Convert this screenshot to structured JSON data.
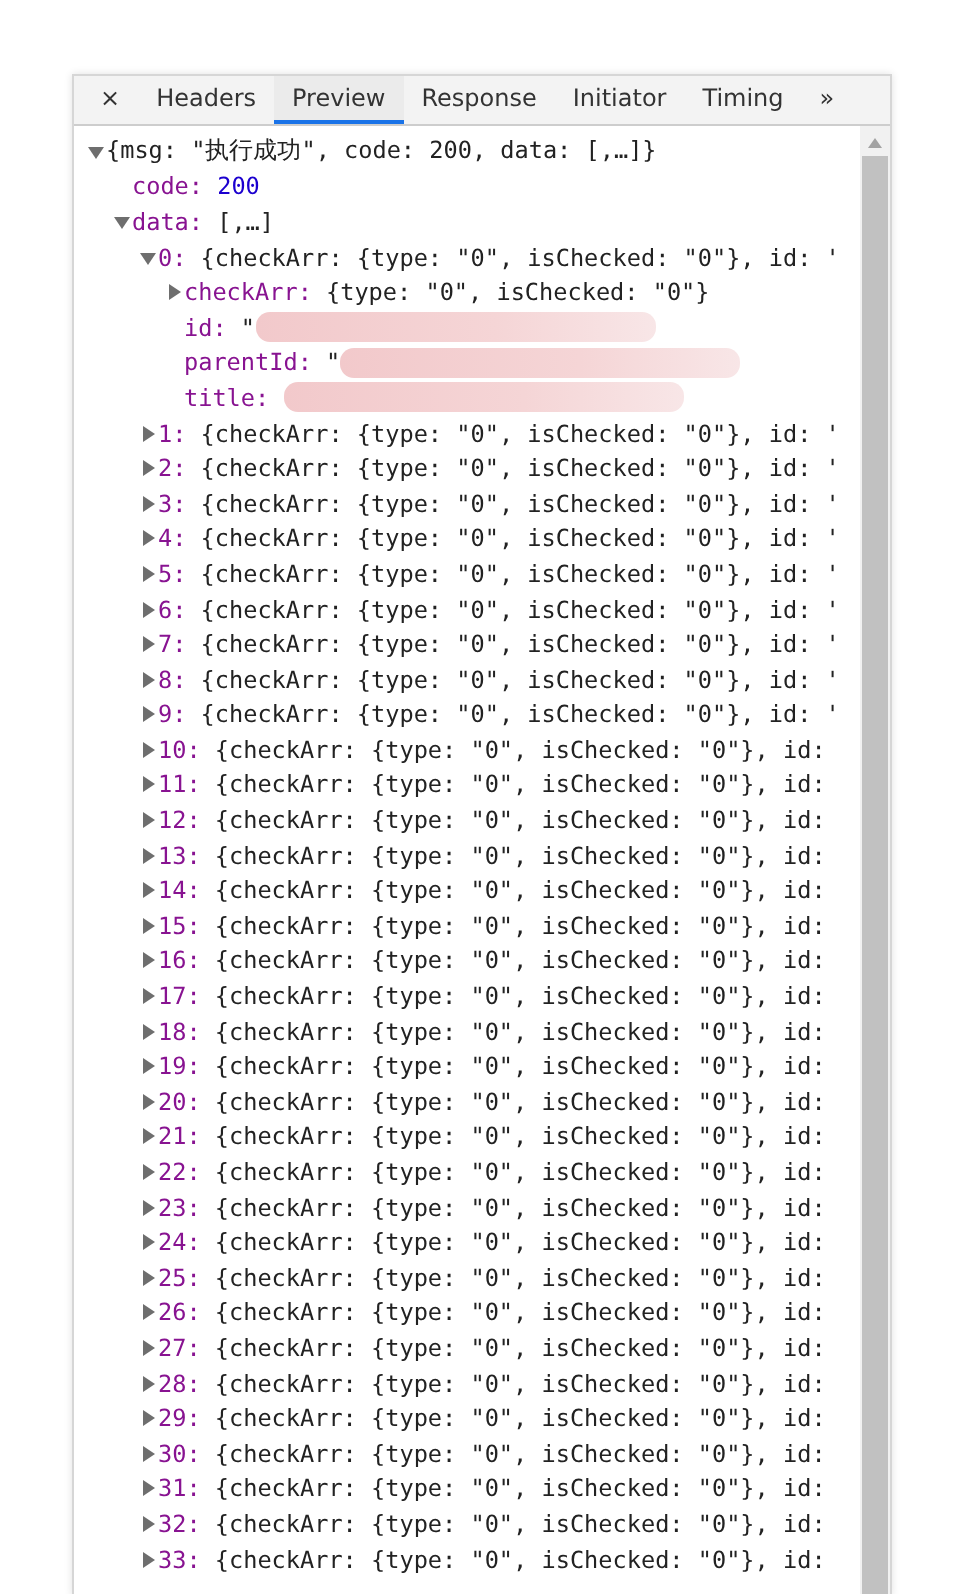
{
  "tabs": [
    {
      "label": "×",
      "kind": "close"
    },
    {
      "label": "Headers",
      "kind": "tab",
      "selected": false
    },
    {
      "label": "Preview",
      "kind": "tab",
      "selected": true
    },
    {
      "label": "Response",
      "kind": "tab",
      "selected": false
    },
    {
      "label": "Initiator",
      "kind": "tab",
      "selected": false
    },
    {
      "label": "Timing",
      "kind": "tab",
      "selected": false
    },
    {
      "label": "»",
      "kind": "more"
    }
  ],
  "tree": {
    "value": "{msg: \"执行成功\", code: 200, data: [,…]}",
    "expanded": true,
    "children": [
      {
        "key": "code:",
        "value": "200",
        "kind": "number"
      },
      {
        "key": "data:",
        "value": "[,…]",
        "expanded": true,
        "children": [
          {
            "key": "0:",
            "value": "{checkArr: {type: \"0\", isChecked: \"0\"}, id: '",
            "expanded": true,
            "children": [
              {
                "key": "checkArr:",
                "value": "{type: \"0\", isChecked: \"0\"}",
                "expanded": false
              },
              {
                "key": "id:",
                "value": "\"",
                "redacted": true
              },
              {
                "key": "parentId:",
                "value": "\"",
                "redacted": true
              },
              {
                "key": "title:",
                "redacted": true
              }
            ]
          },
          {
            "key": "1:",
            "value": "{checkArr: {type: \"0\", isChecked: \"0\"}, id: '",
            "expanded": false
          },
          {
            "key": "2:",
            "value": "{checkArr: {type: \"0\", isChecked: \"0\"}, id: '",
            "expanded": false
          },
          {
            "key": "3:",
            "value": "{checkArr: {type: \"0\", isChecked: \"0\"}, id: '",
            "expanded": false
          },
          {
            "key": "4:",
            "value": "{checkArr: {type: \"0\", isChecked: \"0\"}, id: '",
            "expanded": false
          },
          {
            "key": "5:",
            "value": "{checkArr: {type: \"0\", isChecked: \"0\"}, id: '",
            "expanded": false
          },
          {
            "key": "6:",
            "value": "{checkArr: {type: \"0\", isChecked: \"0\"}, id: '",
            "expanded": false
          },
          {
            "key": "7:",
            "value": "{checkArr: {type: \"0\", isChecked: \"0\"}, id: '",
            "expanded": false
          },
          {
            "key": "8:",
            "value": "{checkArr: {type: \"0\", isChecked: \"0\"}, id: '",
            "expanded": false
          },
          {
            "key": "9:",
            "value": "{checkArr: {type: \"0\", isChecked: \"0\"}, id: '",
            "expanded": false
          },
          {
            "key": "10:",
            "value": "{checkArr: {type: \"0\", isChecked: \"0\"}, id:",
            "expanded": false
          },
          {
            "key": "11:",
            "value": "{checkArr: {type: \"0\", isChecked: \"0\"}, id:",
            "expanded": false
          },
          {
            "key": "12:",
            "value": "{checkArr: {type: \"0\", isChecked: \"0\"}, id:",
            "expanded": false
          },
          {
            "key": "13:",
            "value": "{checkArr: {type: \"0\", isChecked: \"0\"}, id:",
            "expanded": false
          },
          {
            "key": "14:",
            "value": "{checkArr: {type: \"0\", isChecked: \"0\"}, id:",
            "expanded": false
          },
          {
            "key": "15:",
            "value": "{checkArr: {type: \"0\", isChecked: \"0\"}, id:",
            "expanded": false
          },
          {
            "key": "16:",
            "value": "{checkArr: {type: \"0\", isChecked: \"0\"}, id:",
            "expanded": false
          },
          {
            "key": "17:",
            "value": "{checkArr: {type: \"0\", isChecked: \"0\"}, id:",
            "expanded": false
          },
          {
            "key": "18:",
            "value": "{checkArr: {type: \"0\", isChecked: \"0\"}, id:",
            "expanded": false
          },
          {
            "key": "19:",
            "value": "{checkArr: {type: \"0\", isChecked: \"0\"}, id:",
            "expanded": false
          },
          {
            "key": "20:",
            "value": "{checkArr: {type: \"0\", isChecked: \"0\"}, id:",
            "expanded": false
          },
          {
            "key": "21:",
            "value": "{checkArr: {type: \"0\", isChecked: \"0\"}, id:",
            "expanded": false
          },
          {
            "key": "22:",
            "value": "{checkArr: {type: \"0\", isChecked: \"0\"}, id:",
            "expanded": false
          },
          {
            "key": "23:",
            "value": "{checkArr: {type: \"0\", isChecked: \"0\"}, id:",
            "expanded": false
          },
          {
            "key": "24:",
            "value": "{checkArr: {type: \"0\", isChecked: \"0\"}, id:",
            "expanded": false
          },
          {
            "key": "25:",
            "value": "{checkArr: {type: \"0\", isChecked: \"0\"}, id:",
            "expanded": false
          },
          {
            "key": "26:",
            "value": "{checkArr: {type: \"0\", isChecked: \"0\"}, id:",
            "expanded": false
          },
          {
            "key": "27:",
            "value": "{checkArr: {type: \"0\", isChecked: \"0\"}, id:",
            "expanded": false
          },
          {
            "key": "28:",
            "value": "{checkArr: {type: \"0\", isChecked: \"0\"}, id:",
            "expanded": false
          },
          {
            "key": "29:",
            "value": "{checkArr: {type: \"0\", isChecked: \"0\"}, id:",
            "expanded": false
          },
          {
            "key": "30:",
            "value": "{checkArr: {type: \"0\", isChecked: \"0\"}, id:",
            "expanded": false
          },
          {
            "key": "31:",
            "value": "{checkArr: {type: \"0\", isChecked: \"0\"}, id:",
            "expanded": false
          },
          {
            "key": "32:",
            "value": "{checkArr: {type: \"0\", isChecked: \"0\"}, id:",
            "expanded": false
          },
          {
            "key": "33:",
            "value": "{checkArr: {type: \"0\", isChecked: \"0\"}, id:",
            "expanded": false
          }
        ]
      }
    ]
  }
}
